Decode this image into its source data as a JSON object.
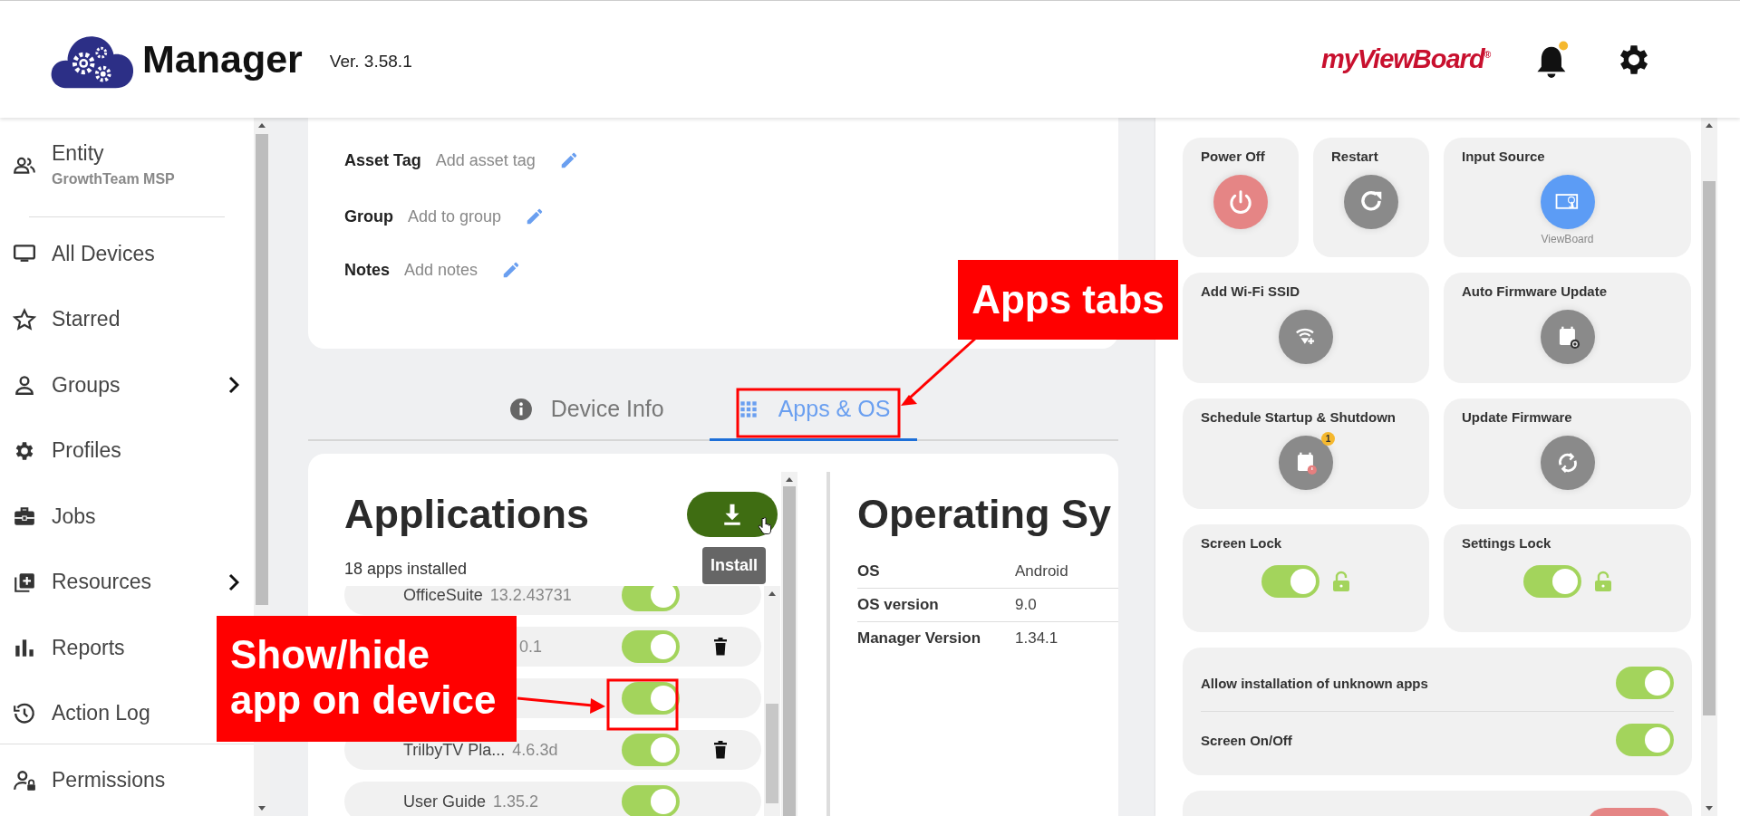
{
  "header": {
    "app_name": "Manager",
    "version": "Ver. 3.58.1",
    "brand": "myViewBoard$^{®}$",
    "notifications_unread": true
  },
  "sidebar": {
    "entity": {
      "label": "Entity",
      "name": "GrowthTeam MSP"
    },
    "items": [
      {
        "label": "All Devices",
        "has_submenu": false
      },
      {
        "label": "Starred",
        "has_submenu": false
      },
      {
        "label": "Groups",
        "has_submenu": true
      },
      {
        "label": "Profiles",
        "has_submenu": false
      },
      {
        "label": "Jobs",
        "has_submenu": false
      },
      {
        "label": "Resources",
        "has_submenu": true
      },
      {
        "label": "Reports",
        "has_submenu": false
      },
      {
        "label": "Action Log",
        "has_submenu": false
      }
    ],
    "footer_item": {
      "label": "Permissions"
    }
  },
  "device_fields": [
    {
      "label": "Asset Tag",
      "placeholder": "Add asset tag"
    },
    {
      "label": "Group",
      "placeholder": "Add to group"
    },
    {
      "label": "Notes",
      "placeholder": "Add notes"
    }
  ],
  "tabs": [
    {
      "label": "Device Info",
      "selected": false
    },
    {
      "label": "Apps & OS",
      "selected": true
    }
  ],
  "applications": {
    "title": "Applications",
    "count": "18 apps installed",
    "install_tooltip": "Install",
    "apps": [
      {
        "name": "OfficeSuite",
        "version": "13.2.43731",
        "on": true,
        "removable": false
      },
      {
        "version": "0.1",
        "on": true,
        "removable": true
      },
      {
        "on": true,
        "removable": false
      },
      {
        "name": "TrilbyTV Pla...",
        "version": "4.6.3d",
        "on": true,
        "removable": true
      },
      {
        "name": "User Guide",
        "version": "1.35.2",
        "on": true,
        "removable": false
      }
    ]
  },
  "operating_system": {
    "title": "Operating Sy",
    "rows": [
      {
        "label": "OS",
        "value": "Android"
      },
      {
        "label": "OS version",
        "value": "9.0"
      },
      {
        "label": "Manager Version",
        "value": "1.34.1"
      }
    ]
  },
  "controls": {
    "actions": [
      {
        "label": "Power Off",
        "kind": "power"
      },
      {
        "label": "Restart",
        "kind": "restart"
      },
      {
        "label": "Input Source",
        "kind": "source",
        "caption": "ViewBoard"
      },
      {
        "label": "Add Wi-Fi SSID",
        "kind": "wifi"
      },
      {
        "label": "Auto Firmware Update",
        "kind": "auto-update"
      },
      {
        "label": "Schedule Startup & Shutdown",
        "kind": "schedule",
        "badge": "1"
      },
      {
        "label": "Update Firmware",
        "kind": "update"
      }
    ],
    "locks": [
      {
        "label": "Screen Lock",
        "on": true
      },
      {
        "label": "Settings Lock",
        "on": true
      }
    ],
    "switches": [
      {
        "label": "Allow installation of unknown apps",
        "on": true
      },
      {
        "label": "Screen On/Off",
        "on": true
      }
    ]
  },
  "annotations": [
    {
      "text": "Apps tabs"
    },
    {
      "text": "Show/hide app on device"
    }
  ]
}
